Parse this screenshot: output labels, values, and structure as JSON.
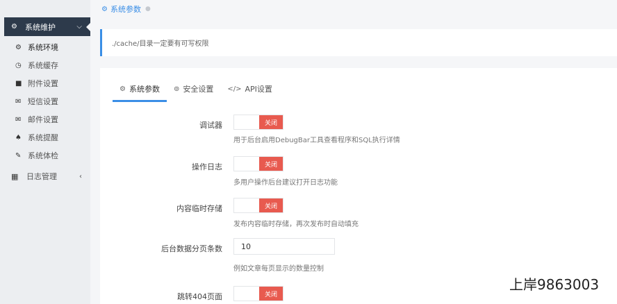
{
  "sidebar": {
    "group": {
      "icon": "gear-icon",
      "label": "系统维护",
      "chevron": "chevron-down-icon"
    },
    "items": [
      {
        "icon": "gear-icon",
        "label": "系统环境",
        "active": true
      },
      {
        "icon": "clock-icon",
        "label": "系统缓存"
      },
      {
        "icon": "folder-icon",
        "label": "附件设置"
      },
      {
        "icon": "envelope-icon",
        "label": "短信设置"
      },
      {
        "icon": "mail-open-icon",
        "label": "邮件设置"
      },
      {
        "icon": "bell-icon",
        "label": "系统提醒"
      },
      {
        "icon": "wrench-icon",
        "label": "系统体检"
      }
    ],
    "log": {
      "icon": "calendar-icon",
      "label": "日志管理",
      "chevron": "chevron-left-icon"
    }
  },
  "breadcrumb": {
    "icon": "gear-icon",
    "label": "系统参数"
  },
  "notice": {
    "text": "./cache/目录一定要有可写权限"
  },
  "tabs": [
    {
      "icon": "gear-icon",
      "label": "系统参数",
      "active": true
    },
    {
      "icon": "shield-icon",
      "label": "安全设置"
    },
    {
      "icon": "code-icon",
      "label": "API设置"
    }
  ],
  "settings": {
    "debugger": {
      "label": "调试器",
      "toggle": "关闭",
      "help": "用于后台启用DebugBar工具查看程序和SQL执行详情"
    },
    "oplog": {
      "label": "操作日志",
      "toggle": "关闭",
      "help": "多用户操作后台建议打开日志功能"
    },
    "tempstore": {
      "label": "内容临时存储",
      "toggle": "关闭",
      "help": "发布内容临时存储，再次发布时自动填充"
    },
    "pagesize": {
      "label": "后台数据分页条数",
      "value": "10",
      "help": "例如文章每页显示的数量控制"
    },
    "page404": {
      "label": "跳转404页面",
      "toggle": "关闭"
    }
  },
  "watermark": "上岸9863003",
  "colors": {
    "primary": "#3a8ee6",
    "toggle_off": "#e85a4f",
    "sidebar_group_bg": "#2d3a4b"
  }
}
